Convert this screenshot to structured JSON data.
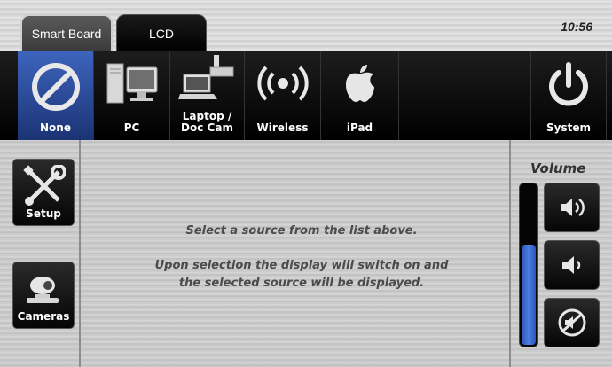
{
  "tabs": [
    {
      "label": "Smart Board",
      "active": true
    },
    {
      "label": "LCD",
      "active": false
    }
  ],
  "clock": "10:56",
  "sources": [
    {
      "label": "None",
      "icon": "none-prohibited-icon",
      "selected": true
    },
    {
      "label": "PC",
      "icon": "pc-icon",
      "selected": false
    },
    {
      "label": "Laptop /\nDoc Cam",
      "icon": "laptop-doc-cam-icon",
      "selected": false
    },
    {
      "label": "Wireless",
      "icon": "wireless-icon",
      "selected": false
    },
    {
      "label": "iPad",
      "icon": "apple-icon",
      "selected": false
    },
    {
      "label": "",
      "icon": "",
      "selected": false
    },
    {
      "label": "System",
      "icon": "power-icon",
      "selected": false
    }
  ],
  "side_buttons": {
    "setup": {
      "label": "Setup",
      "icon": "tools-icon"
    },
    "cameras": {
      "label": "Cameras",
      "icon": "camera-icon"
    }
  },
  "message": {
    "line1": "Select a source from the list above.",
    "line2": "Upon selection the display will switch on and",
    "line3": "the selected source will be displayed."
  },
  "volume": {
    "title": "Volume",
    "level_fraction": 0.62,
    "up_icon": "volume-up-icon",
    "down_icon": "volume-down-icon",
    "mute_icon": "mute-icon"
  },
  "colors": {
    "selected_blue": "#2c55b8",
    "bar_black": "#000000"
  }
}
